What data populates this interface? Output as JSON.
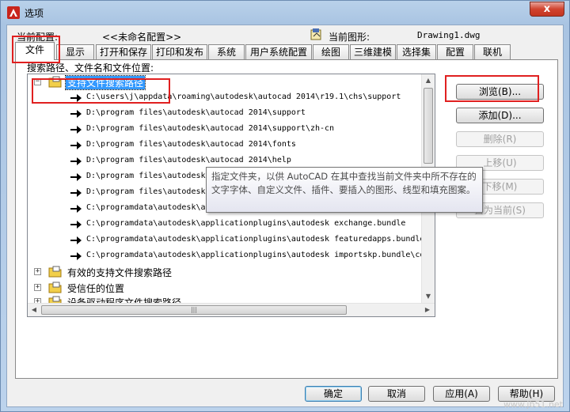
{
  "window": {
    "title": "选项",
    "close_label": "x"
  },
  "profile": {
    "label": "当前配置:",
    "value": "<<未命名配置>>",
    "drawing_label": "当前图形:",
    "drawing_value": "Drawing1.dwg"
  },
  "tabs": [
    {
      "label": "文件"
    },
    {
      "label": "显示"
    },
    {
      "label": "打开和保存"
    },
    {
      "label": "打印和发布"
    },
    {
      "label": "系统"
    },
    {
      "label": "用户系统配置"
    },
    {
      "label": "绘图"
    },
    {
      "label": "三维建模"
    },
    {
      "label": "选择集"
    },
    {
      "label": "配置"
    },
    {
      "label": "联机"
    }
  ],
  "panel": {
    "label": "搜索路径、文件名和文件位置:",
    "tree": {
      "root": {
        "label": "支持文件搜索路径",
        "expander": "−"
      },
      "paths": [
        "C:\\users\\j\\appdata\\roaming\\autodesk\\autocad 2014\\r19.1\\chs\\support",
        "D:\\program files\\autodesk\\autocad 2014\\support",
        "D:\\program files\\autodesk\\autocad 2014\\support\\zh-cn",
        "D:\\program files\\autodesk\\autocad 2014\\fonts",
        "D:\\program files\\autodesk\\autocad 2014\\help",
        "D:\\program files\\autodesk\\autocad 2014\\express",
        "D:\\program files\\autodesk\\autocad 2014\\support\\color",
        "C:\\programdata\\autodesk\\applicationplugins\\autodesk appmanager.bundle",
        "C:\\programdata\\autodesk\\applicationplugins\\autodesk exchange.bundle",
        "C:\\programdata\\autodesk\\applicationplugins\\autodesk featuredapps.bundle",
        "C:\\programdata\\autodesk\\applicationplugins\\autodesk importskp.bundle\\contents"
      ],
      "groups": [
        {
          "label": "有效的支持文件搜索路径",
          "expander": "+"
        },
        {
          "label": "受信任的位置",
          "expander": "+"
        },
        {
          "label": "设备驱动程序文件搜索路径",
          "expander": "+"
        }
      ]
    },
    "side_buttons": {
      "browse": "浏览(B)...",
      "add": "添加(D)...",
      "remove": "删除(R)",
      "move_up": "上移(U)",
      "move_down": "下移(M)",
      "set_current": "置为当前(S)"
    },
    "tooltip": "指定文件夹，以供 AutoCAD 在其中查找当前文件夹中所不存在的文字字体、自定义文件、插件、要插入的图形、线型和填充图案。"
  },
  "buttons": {
    "ok": "确定",
    "cancel": "取消",
    "apply": "应用(A)",
    "help": "帮助(H)"
  },
  "watermark": "www.jb51.net",
  "colors": {
    "highlight": "#e02020",
    "selection": "#3399ff"
  }
}
